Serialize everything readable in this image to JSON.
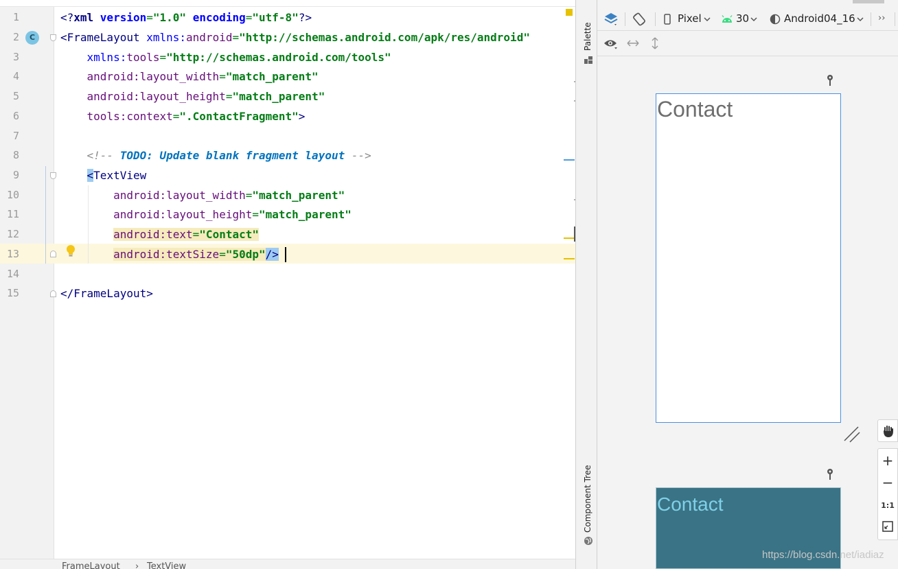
{
  "editor": {
    "line_numbers": [
      "1",
      "2",
      "3",
      "4",
      "5",
      "6",
      "7",
      "8",
      "9",
      "10",
      "11",
      "12",
      "13",
      "14",
      "15"
    ],
    "class_badge": "C",
    "code": {
      "l1": {
        "a": "<?",
        "b": "xml ",
        "c": "version",
        "d": "=",
        "e": "\"1.0\"",
        "f": " ",
        "g": "encoding",
        "h": "=",
        "i": "\"utf-8\"",
        "j": "?>"
      },
      "l2": {
        "a": "<FrameLayout ",
        "b": "xmlns:",
        "c": "android",
        "d": "=",
        "e": "\"http://schemas.android.com/apk/res/android\""
      },
      "l3": {
        "a": "    ",
        "b": "xmlns:",
        "c": "tools",
        "d": "=",
        "e": "\"http://schemas.android.com/tools\""
      },
      "l4": {
        "a": "    ",
        "b": "android:",
        "c": "layout_width",
        "d": "=",
        "e": "\"match_parent\""
      },
      "l5": {
        "a": "    ",
        "b": "android:",
        "c": "layout_height",
        "d": "=",
        "e": "\"match_parent\""
      },
      "l6": {
        "a": "    ",
        "b": "tools:",
        "c": "context",
        "d": "=",
        "e": "\".ContactFragment\"",
        "f": ">"
      },
      "l8": {
        "a": "    ",
        "b": "<!-- ",
        "c": "TODO: Update blank fragment layout",
        "d": " -->"
      },
      "l9": {
        "a": "    ",
        "b": "<",
        "c": "TextView"
      },
      "l10": {
        "a": "        ",
        "b": "android:",
        "c": "layout_width",
        "d": "=",
        "e": "\"match_parent\""
      },
      "l11": {
        "a": "        ",
        "b": "android:",
        "c": "layout_height",
        "d": "=",
        "e": "\"match_parent\""
      },
      "l12": {
        "a": "        ",
        "b": "android:",
        "c": "text",
        "d": "=",
        "e": "\"Contact\""
      },
      "l13": {
        "a": "        ",
        "b": "android:",
        "c": "textSize",
        "d": "=",
        "e": "\"50dp\"",
        "f": "/>"
      },
      "l15": {
        "a": "</FrameLayout>"
      }
    }
  },
  "breadcrumb": {
    "items": [
      "FrameLayout",
      "›",
      "TextView"
    ]
  },
  "side_tabs": {
    "palette": "Palette",
    "component_tree": "Component Tree"
  },
  "design_toolbar": {
    "device": "Pixel",
    "api_level": "30",
    "theme": "Android04_16",
    "overflow": "››"
  },
  "preview": {
    "design_text": "Contact",
    "blueprint_text": "Contact"
  },
  "zoom_controls": {
    "zoom_in": "+",
    "zoom_out": "−",
    "actual_size": "1:1"
  },
  "watermark": "https://blog.csdn.net/iadiaz",
  "colors": {
    "accent": "#4a90e2",
    "blueprint": "#3a7385",
    "string": "#067d17",
    "attribute": "#660e7a",
    "namespace": "#0000ff",
    "tag": "#000080"
  }
}
